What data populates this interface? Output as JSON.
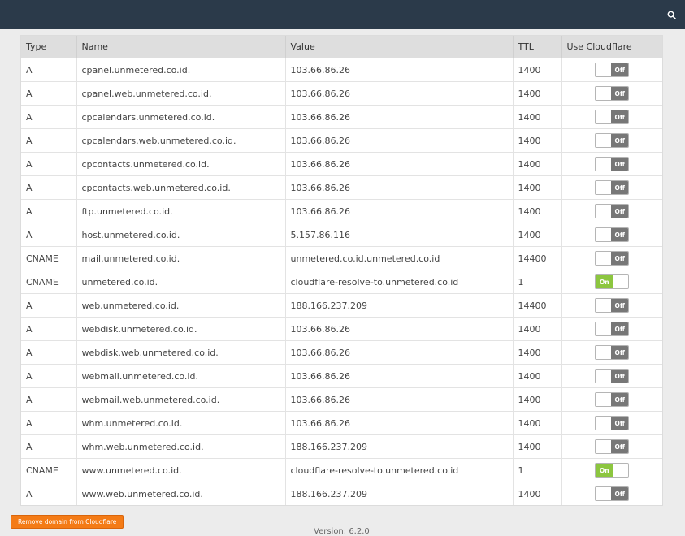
{
  "table": {
    "headers": [
      "Type",
      "Name",
      "Value",
      "TTL",
      "Use Cloudflare"
    ],
    "rows": [
      {
        "type": "A",
        "name": "cpanel.unmetered.co.id.",
        "value": "103.66.86.26",
        "ttl": "1400",
        "cf": "Off"
      },
      {
        "type": "A",
        "name": "cpanel.web.unmetered.co.id.",
        "value": "103.66.86.26",
        "ttl": "1400",
        "cf": "Off"
      },
      {
        "type": "A",
        "name": "cpcalendars.unmetered.co.id.",
        "value": "103.66.86.26",
        "ttl": "1400",
        "cf": "Off"
      },
      {
        "type": "A",
        "name": "cpcalendars.web.unmetered.co.id.",
        "value": "103.66.86.26",
        "ttl": "1400",
        "cf": "Off"
      },
      {
        "type": "A",
        "name": "cpcontacts.unmetered.co.id.",
        "value": "103.66.86.26",
        "ttl": "1400",
        "cf": "Off"
      },
      {
        "type": "A",
        "name": "cpcontacts.web.unmetered.co.id.",
        "value": "103.66.86.26",
        "ttl": "1400",
        "cf": "Off"
      },
      {
        "type": "A",
        "name": "ftp.unmetered.co.id.",
        "value": "103.66.86.26",
        "ttl": "1400",
        "cf": "Off"
      },
      {
        "type": "A",
        "name": "host.unmetered.co.id.",
        "value": "5.157.86.116",
        "ttl": "1400",
        "cf": "Off"
      },
      {
        "type": "CNAME",
        "name": "mail.unmetered.co.id.",
        "value": "unmetered.co.id.unmetered.co.id",
        "ttl": "14400",
        "cf": "Off"
      },
      {
        "type": "CNAME",
        "name": "unmetered.co.id.",
        "value": "cloudflare-resolve-to.unmetered.co.id",
        "ttl": "1",
        "cf": "On"
      },
      {
        "type": "A",
        "name": "web.unmetered.co.id.",
        "value": "188.166.237.209",
        "ttl": "14400",
        "cf": "Off"
      },
      {
        "type": "A",
        "name": "webdisk.unmetered.co.id.",
        "value": "103.66.86.26",
        "ttl": "1400",
        "cf": "Off"
      },
      {
        "type": "A",
        "name": "webdisk.web.unmetered.co.id.",
        "value": "103.66.86.26",
        "ttl": "1400",
        "cf": "Off"
      },
      {
        "type": "A",
        "name": "webmail.unmetered.co.id.",
        "value": "103.66.86.26",
        "ttl": "1400",
        "cf": "Off"
      },
      {
        "type": "A",
        "name": "webmail.web.unmetered.co.id.",
        "value": "103.66.86.26",
        "ttl": "1400",
        "cf": "Off"
      },
      {
        "type": "A",
        "name": "whm.unmetered.co.id.",
        "value": "103.66.86.26",
        "ttl": "1400",
        "cf": "Off"
      },
      {
        "type": "A",
        "name": "whm.web.unmetered.co.id.",
        "value": "188.166.237.209",
        "ttl": "1400",
        "cf": "Off"
      },
      {
        "type": "CNAME",
        "name": "www.unmetered.co.id.",
        "value": "cloudflare-resolve-to.unmetered.co.id",
        "ttl": "1",
        "cf": "On"
      },
      {
        "type": "A",
        "name": "www.web.unmetered.co.id.",
        "value": "188.166.237.209",
        "ttl": "1400",
        "cf": "Off"
      }
    ]
  },
  "footer": {
    "remove_label": "Remove domain from Cloudflare",
    "version": "Version: 6.2.0"
  },
  "icons": {
    "search": "search-icon"
  },
  "colors": {
    "topbar": "#2b3a4a",
    "toggle_on": "#8cc63f",
    "toggle_off": "#777777",
    "remove_button": "#f47b16"
  }
}
